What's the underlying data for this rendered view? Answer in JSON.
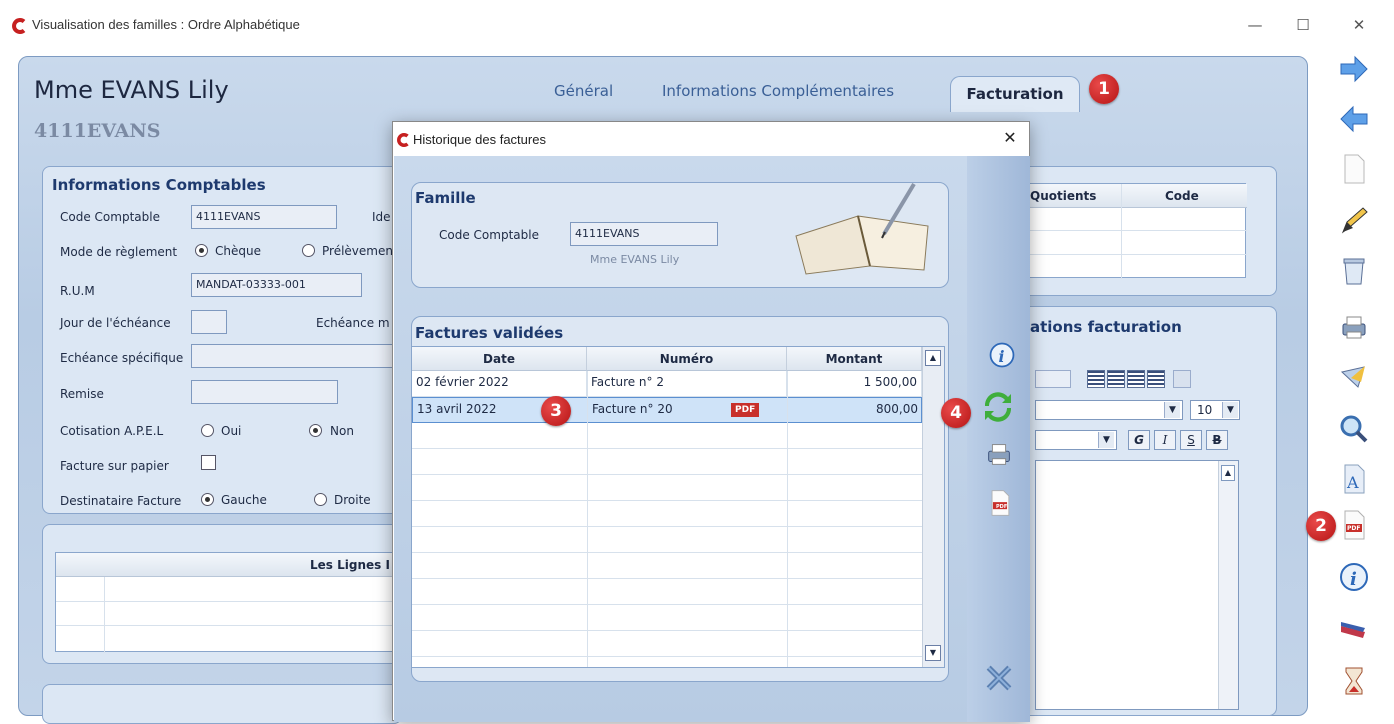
{
  "window": {
    "title": "Visualisation des familles : Ordre Alphabétique",
    "min_glyph": "—",
    "max_glyph": "☐",
    "close_glyph": "✕"
  },
  "header": {
    "family_name": "Mme EVANS Lily",
    "account_code": "4111EVANS"
  },
  "tabs": [
    {
      "label": "Général"
    },
    {
      "label": "Informations Complémentaires"
    },
    {
      "label": "Facturation",
      "active": true
    }
  ],
  "badges": {
    "b1": "1",
    "b2": "2",
    "b3": "3",
    "b4": "4"
  },
  "accounting": {
    "title": "Informations Comptables",
    "code_label": "Code Comptable",
    "code_value": "4111EVANS",
    "ide_label": "Ide",
    "mode_label": "Mode de règlement",
    "mode_opt1": "Chèque",
    "mode_opt2": "Prélèvemen",
    "rum_label": "R.U.M",
    "rum_value": "MANDAT-03333-001",
    "jour_label": "Jour de l'échéance",
    "echeance_m_label": "Echéance m",
    "echeance_spec_label": "Echéance spécifique",
    "remise_label": "Remise",
    "apel_label": "Cotisation A.P.E.L",
    "apel_yes": "Oui",
    "apel_no": "Non",
    "paper_label": "Facture sur papier",
    "dest_label": "Destinataire Facture",
    "dest_left": "Gauche",
    "dest_right": "Droite"
  },
  "lines_group": {
    "header": "Les Lignes I"
  },
  "quotients": {
    "col1": "Quotients",
    "col2": "Code"
  },
  "billing_info": {
    "title": "ations facturation",
    "font_size": "10",
    "fmt_g": "G",
    "fmt_i": "I",
    "fmt_s": "S",
    "fmt_b": "B"
  },
  "dialog": {
    "title": "Historique des factures",
    "close_glyph": "✕",
    "famille_title": "Famille",
    "code_label": "Code Comptable",
    "code_value": "4111EVANS",
    "family_name": "Mme EVANS Lily",
    "invoices_title": "Factures validées",
    "columns": {
      "date": "Date",
      "numero": "Numéro",
      "montant": "Montant"
    },
    "rows": [
      {
        "date": "02 février 2022",
        "numero": "Facture n° 2",
        "montant": "1 500,00",
        "pdf": ""
      },
      {
        "date": "13 avril 2022",
        "numero": "Facture n° 20",
        "montant": "800,00",
        "pdf": "PDF"
      }
    ],
    "pdf_icon_text": "PDF"
  },
  "toolbar_pdf_text": "PDF",
  "colors": {
    "accent": "#3a5f96",
    "badge_red": "#c41c1c",
    "panel_blue": "#c9d9ec"
  }
}
